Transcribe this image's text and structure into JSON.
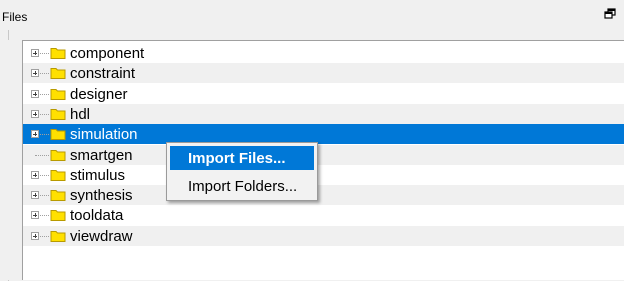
{
  "panel": {
    "title": "Files"
  },
  "tree": {
    "items": [
      {
        "label": "component",
        "expandable": true
      },
      {
        "label": "constraint",
        "expandable": true
      },
      {
        "label": "designer",
        "expandable": true
      },
      {
        "label": "hdl",
        "expandable": true
      },
      {
        "label": "simulation",
        "expandable": true,
        "selected": true
      },
      {
        "label": "smartgen",
        "expandable": false
      },
      {
        "label": "stimulus",
        "expandable": true
      },
      {
        "label": "synthesis",
        "expandable": true
      },
      {
        "label": "tooldata",
        "expandable": true
      },
      {
        "label": "viewdraw",
        "expandable": true
      }
    ]
  },
  "context_menu": {
    "items": [
      {
        "label": "Import Files...",
        "highlighted": true
      },
      {
        "label": "Import Folders...",
        "highlighted": false
      }
    ]
  },
  "colors": {
    "selection": "#0078d7",
    "folder": "#ffe000",
    "folder_outline": "#b89a00",
    "alt_row": "#f0f0f0"
  },
  "icons": {
    "float": "float-window-icon",
    "folder": "folder-icon",
    "expand": "expand-plus-icon"
  }
}
